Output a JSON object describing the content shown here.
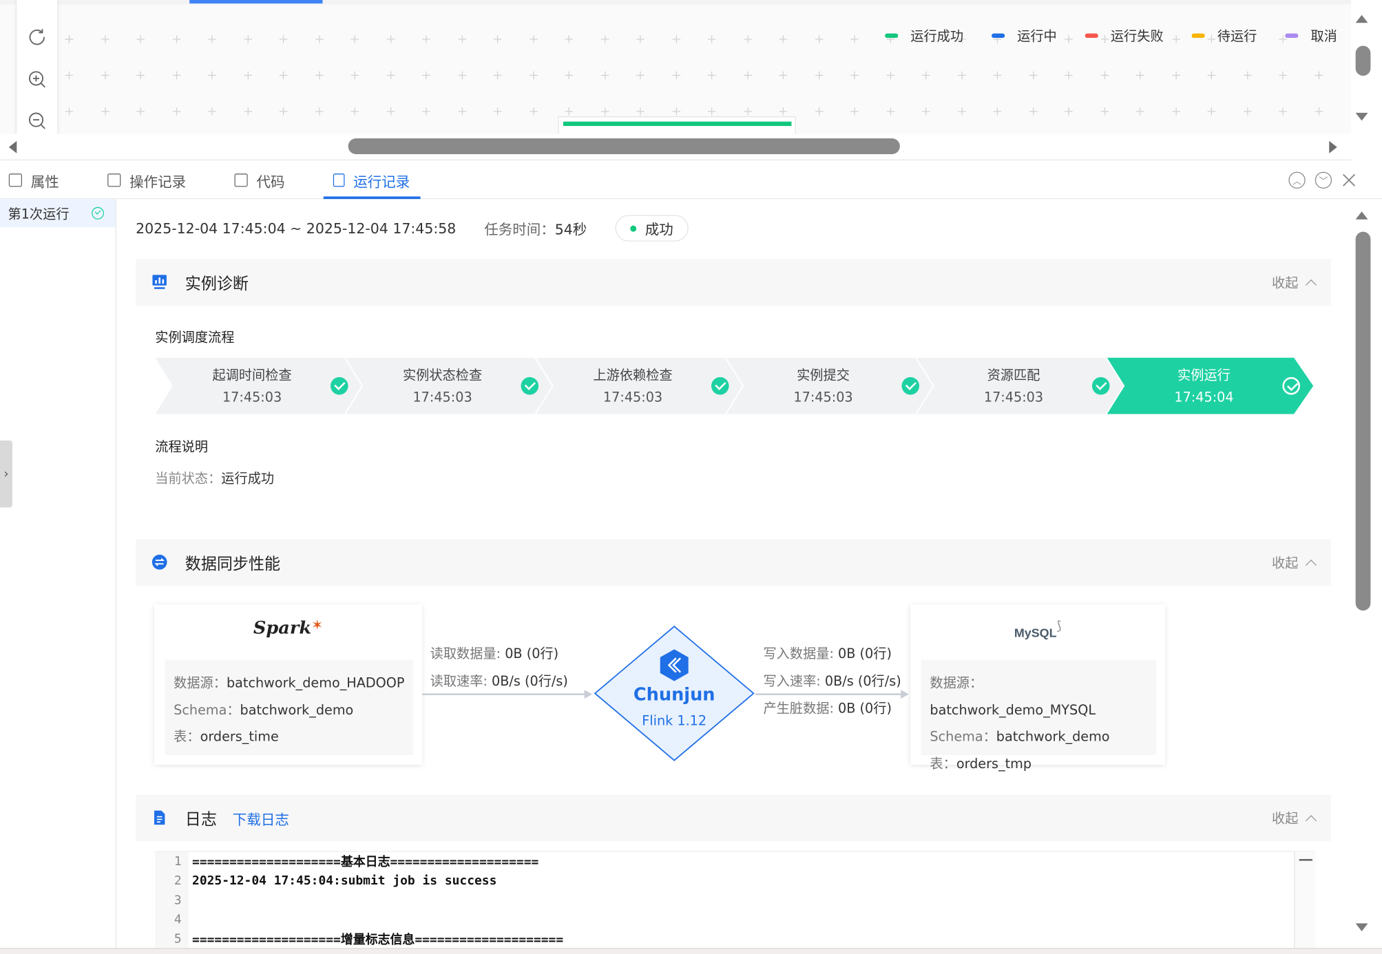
{
  "canvas": {
    "legend": [
      {
        "label": "运行成功",
        "color": "#12c77e"
      },
      {
        "label": "运行中",
        "color": "#1f6fe6"
      },
      {
        "label": "运行失败",
        "color": "#f5584e"
      },
      {
        "label": "待运行",
        "color": "#f7b500"
      },
      {
        "label": "取消",
        "color": "#a98bef"
      }
    ],
    "toolbar_icons": [
      "refresh-icon",
      "zoom-in-icon",
      "zoom-out-icon"
    ]
  },
  "tabs": {
    "items": [
      {
        "label": "属性",
        "icon": "list-icon"
      },
      {
        "label": "操作记录",
        "icon": "checklist-icon"
      },
      {
        "label": "代码",
        "icon": "code-icon"
      },
      {
        "label": "运行记录",
        "icon": "document-icon"
      }
    ],
    "active": "运行记录"
  },
  "runlist": {
    "items": [
      {
        "label": "第1次运行",
        "status": "success"
      }
    ]
  },
  "summary": {
    "time_range": "2025-12-04 17:45:04 ~ 2025-12-04 17:45:58",
    "duration_label": "任务时间：",
    "duration_value": "54秒",
    "status": "成功"
  },
  "diagnosis": {
    "title": "实例诊断",
    "collapse_label": "收起",
    "flow_title": "实例调度流程",
    "steps": [
      {
        "name": "起调时间检查",
        "time": "17:45:03"
      },
      {
        "name": "实例状态检查",
        "time": "17:45:03"
      },
      {
        "name": "上游依赖检查",
        "time": "17:45:03"
      },
      {
        "name": "实例提交",
        "time": "17:45:03"
      },
      {
        "name": "资源匹配",
        "time": "17:45:03"
      },
      {
        "name": "实例运行",
        "time": "17:45:04"
      }
    ],
    "desc_title": "流程说明",
    "current_status_label": "当前状态：",
    "current_status_value": "运行成功"
  },
  "sync": {
    "title": "数据同步性能",
    "collapse_label": "收起",
    "source": {
      "logo": "Spark",
      "datasource_label": "数据源：",
      "datasource": "batchwork_demo_HADOOP",
      "schema_label": "Schema：",
      "schema": "batchwork_demo",
      "table_label": "表：",
      "table": "orders_time"
    },
    "read": {
      "amount_label": "读取数据量: ",
      "amount": "0B (0行)",
      "rate_label": "读取速率: ",
      "rate": "0B/s (0行/s)"
    },
    "engine": {
      "name": "Chunjun",
      "version": "Flink 1.12"
    },
    "write": {
      "amount_label": "写入数据量: ",
      "amount": "0B (0行)",
      "rate_label": "写入速率: ",
      "rate": "0B/s (0行/s)",
      "dirty_label": "产生脏数据: ",
      "dirty": "0B (0行)"
    },
    "target": {
      "logo": "MySQL",
      "datasource_label": "数据源：",
      "datasource": "batchwork_demo_MYSQL",
      "schema_label": "Schema：",
      "schema": "batchwork_demo",
      "table_label": "表：",
      "table": "orders_tmp"
    }
  },
  "logs": {
    "title": "日志",
    "download_label": "下载日志",
    "collapse_label": "收起",
    "lines": [
      {
        "no": "1",
        "text": "====================基本日志===================="
      },
      {
        "no": "2",
        "text": "2025-12-04 17:45:04:submit job is success"
      },
      {
        "no": "3",
        "text": ""
      },
      {
        "no": "4",
        "text": ""
      },
      {
        "no": "5",
        "text": "====================增量标志信息===================="
      }
    ]
  },
  "colors": {
    "accent": "#1f6fe6",
    "success": "#12c77e",
    "step_done": "#1ed1a2"
  }
}
